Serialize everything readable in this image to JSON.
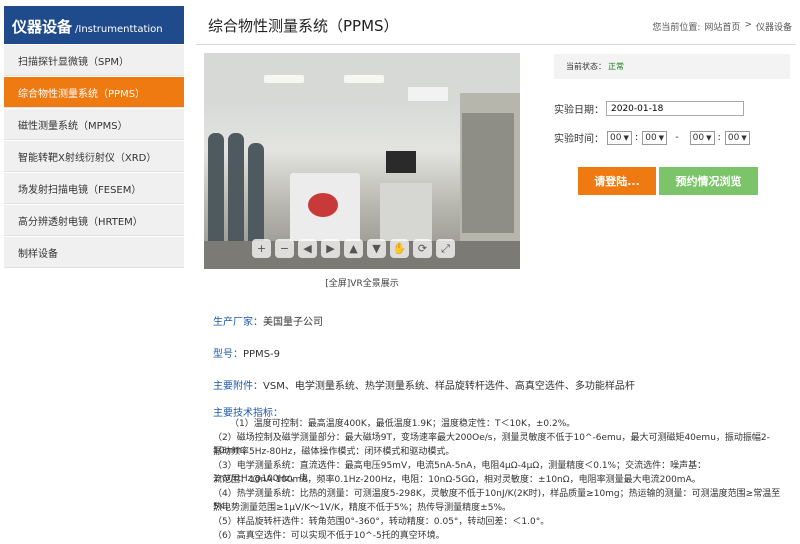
{
  "sidebar": {
    "title_cn": "仪器设备",
    "title_en": "/Instrumenttation",
    "items": [
      {
        "label": "扫描探针显微镜（SPM）"
      },
      {
        "label": "综合物性测量系统（PPMS）"
      },
      {
        "label": "磁性测量系统（MPMS）"
      },
      {
        "label": "智能转靶X射线衍射仪（XRD）"
      },
      {
        "label": "场发射扫描电镜（FESEM）"
      },
      {
        "label": "高分辨透射电镜（HRTEM）"
      },
      {
        "label": "制样设备"
      }
    ]
  },
  "header": {
    "title": "综合物性测量系统（PPMS）",
    "breadcrumb": {
      "prefix": "您当前位置:",
      "home": "网站首页",
      "sep": ">",
      "current": "仪器设备"
    }
  },
  "panorama": {
    "controls": [
      {
        "icon": "zoom-in-icon",
        "glyph": "+"
      },
      {
        "icon": "zoom-out-icon",
        "glyph": "−"
      },
      {
        "icon": "arrow-left-icon",
        "glyph": "◀"
      },
      {
        "icon": "arrow-right-icon",
        "glyph": "▶"
      },
      {
        "icon": "arrow-up-icon",
        "glyph": "▲"
      },
      {
        "icon": "arrow-down-icon",
        "glyph": "▼"
      },
      {
        "icon": "hand-icon",
        "glyph": "✋"
      },
      {
        "icon": "rotate-icon",
        "glyph": "⟳"
      },
      {
        "icon": "fullscreen-icon",
        "glyph": "⤢"
      }
    ],
    "caption": "[全屏]VR全景展示"
  },
  "booking": {
    "status_label": "当前状态：",
    "status_value": "正常",
    "date_label": "实验日期：",
    "date_value": "2020-01-18",
    "time_label": "实验时间：",
    "start_hour": "00",
    "start_min": "00",
    "end_hour": "00",
    "end_min": "00",
    "colon": ":",
    "range_sep": "-",
    "login_button": "请登陆...",
    "browse_button": "预约情况浏览",
    "colors": {
      "login": "#f07a12",
      "browse": "#7cc46a",
      "status_ok": "#1d7b1d"
    }
  },
  "details": {
    "maker_label": "生产厂家：",
    "maker_value": "美国量子公司",
    "model_label": "型号：",
    "model_value": "PPMS-9",
    "accessories_label": "主要附件：",
    "accessories_value": "VSM、电学测量系统、热学测量系统、样品旋转杆选件、高真空选件、多功能样品杆",
    "specs_heading": "主要技术指标：",
    "specs": [
      "（1）温度可控制：最高温度400K，最低温度1.9K；温度稳定性：T＜10K，±0.2%。",
      "（2）磁场控制及磁学测量部分：最大磁场9T，变场速率最大200Oe/s，测量灵敏度不低于10^-6emu，最大可测磁矩40emu，振动振幅2-10mm，",
      "振动频率5Hz-80Hz，磁体操作模式：闭环模式和驱动模式。",
      "（3）电学测量系统：直流选件：最高电压95mV，电流5nA-5nA，电阻4μΩ-4μΩ，测量精度＜0.1%；交流选件：噪声基：1nV/rtHz@100Hz，电",
      "流范围：10nA-100mA，频率0.1Hz-200Hz，电阻：10nΩ-5GΩ，相对灵敏度：±10nΩ，电阻率测量最大电流200mA。",
      "（4）热学测量系统：比热的测量：可测温度5-298K，灵敏度不低于10nJ/K(2K时)，样品质量≥10mg；热运输的测量：可测温度范围≥常温至5K，",
      "热电势测量范围≥1μV/K～1V/K，精度不低于5%；热传导测量精度±5%。",
      "（5）样品旋转杆选件：转角范围0°-360°，转动精度：0.05°，转动回差：＜1.0°。",
      "（6）高真空选件：可以实现不低于10^-5托的真空环境。"
    ]
  }
}
